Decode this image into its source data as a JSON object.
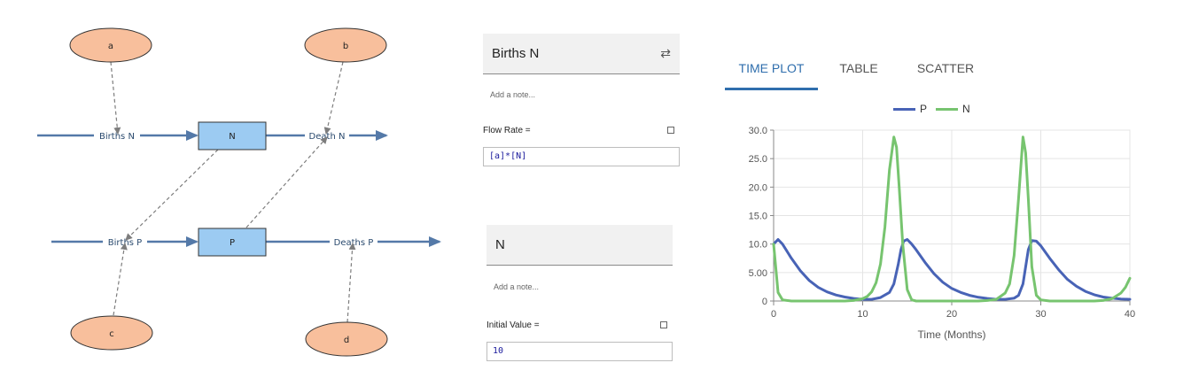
{
  "diagram": {
    "variables": [
      "a",
      "b",
      "c",
      "d"
    ],
    "stocks": [
      "N",
      "P"
    ],
    "flows": [
      "Births N",
      "Death N",
      "Births P",
      "Deaths P"
    ]
  },
  "births_panel": {
    "title": "Births N",
    "note_placeholder": "Add a note...",
    "field_label": "Flow Rate =",
    "equation": "[a]*[N]"
  },
  "n_panel": {
    "title": "N",
    "note_placeholder": "Add a note...",
    "field_label": "Initial Value =",
    "equation": "10"
  },
  "tabs": [
    {
      "label": "TIME PLOT",
      "active": true
    },
    {
      "label": "TABLE",
      "active": false
    },
    {
      "label": "SCATTER",
      "active": false
    }
  ],
  "colors": {
    "accent": "#2f6ead",
    "stock_fill": "#9ccbf2",
    "variable_fill": "#f8bf9c",
    "flow": "#5479a8",
    "series_P": "#4863b6",
    "series_N": "#77c46f"
  },
  "chart_data": {
    "type": "line",
    "xlabel": "Time (Months)",
    "ylabel": "",
    "xlim": [
      0,
      40
    ],
    "ylim": [
      0,
      30
    ],
    "x_ticks": [
      "0",
      "10",
      "20",
      "30",
      "40"
    ],
    "y_ticks": [
      "0",
      "5.00",
      "10.0",
      "15.0",
      "20.0",
      "25.0",
      "30.0"
    ],
    "grid": true,
    "legend_position": "top-center",
    "series": [
      {
        "name": "P",
        "x": [
          0,
          0.5,
          1,
          2,
          3,
          4,
          5,
          6,
          7,
          8,
          9,
          10,
          11,
          12,
          13,
          13.5,
          14,
          14.3,
          14.6,
          15,
          15.5,
          16,
          17,
          18,
          19,
          20,
          21,
          22,
          23,
          24,
          25,
          26,
          27,
          27.5,
          28,
          28.3,
          28.6,
          29,
          29.5,
          30,
          31,
          32,
          33,
          34,
          35,
          36,
          37,
          38,
          39,
          40
        ],
        "y": [
          10,
          10.8,
          10,
          7.5,
          5.3,
          3.6,
          2.4,
          1.6,
          1.05,
          0.7,
          0.45,
          0.3,
          0.3,
          0.6,
          1.5,
          3,
          6.5,
          9,
          10.5,
          10.8,
          10,
          9,
          6.8,
          4.8,
          3.3,
          2.2,
          1.5,
          1.0,
          0.65,
          0.45,
          0.3,
          0.3,
          0.5,
          1,
          3,
          6,
          9,
          10.6,
          10.5,
          9.7,
          7.5,
          5.5,
          3.8,
          2.6,
          1.7,
          1.1,
          0.7,
          0.5,
          0.35,
          0.3
        ]
      },
      {
        "name": "N",
        "x": [
          0,
          0.5,
          1,
          2,
          3,
          4,
          5,
          6,
          7,
          8,
          9,
          10,
          10.5,
          11,
          11.5,
          12,
          12.5,
          13,
          13.5,
          13.8,
          14.1,
          14.5,
          15,
          15.5,
          16,
          17,
          18,
          19,
          20,
          21,
          22,
          23,
          24,
          25,
          26,
          26.5,
          27,
          27.5,
          28,
          28.3,
          28.6,
          29,
          29.5,
          30,
          31,
          32,
          33,
          34,
          35,
          36,
          37,
          38,
          39,
          39.5,
          40
        ],
        "y": [
          10,
          1.5,
          0.2,
          0,
          0,
          0,
          0,
          0,
          0,
          0,
          0.1,
          0.4,
          0.8,
          1.6,
          3.2,
          6.5,
          13,
          23,
          28.8,
          27,
          20,
          10,
          2,
          0.2,
          0,
          0,
          0,
          0,
          0,
          0,
          0,
          0,
          0.1,
          0.3,
          1.4,
          3,
          8,
          18,
          28.8,
          26,
          18,
          6,
          1,
          0.2,
          0,
          0,
          0,
          0,
          0,
          0,
          0.1,
          0.4,
          1.4,
          2.4,
          4
        ]
      }
    ]
  }
}
